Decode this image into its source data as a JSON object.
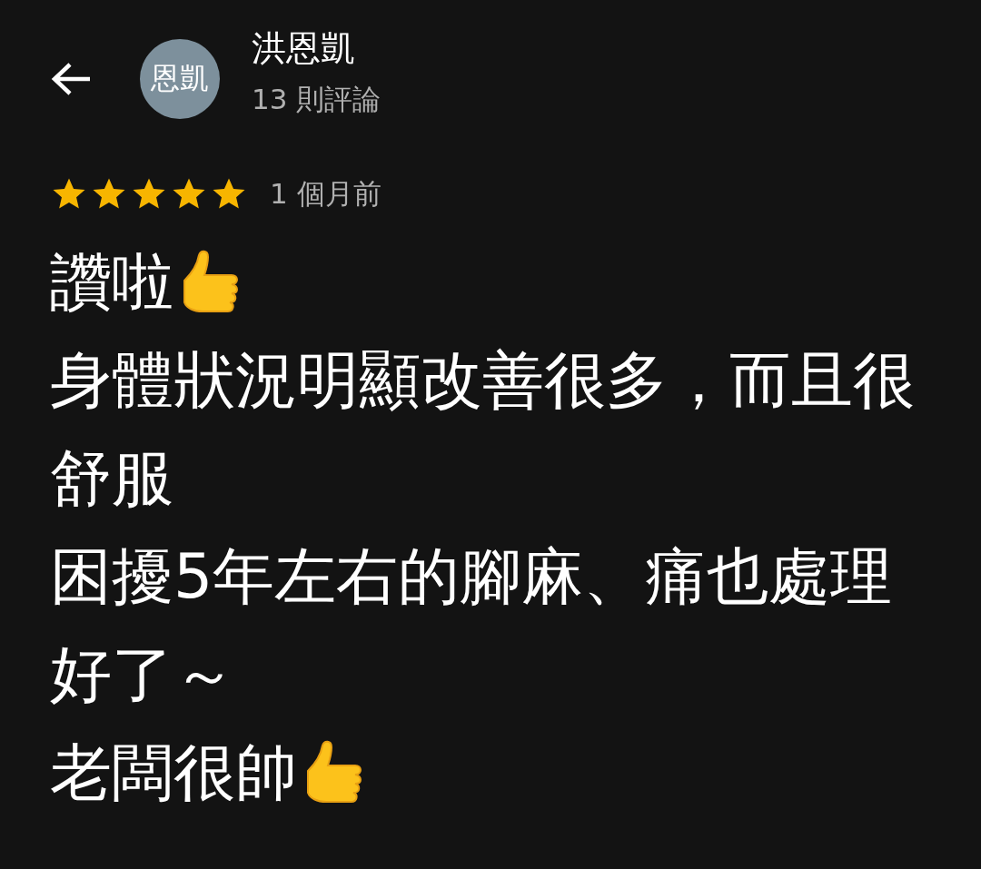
{
  "reviewer": {
    "avatar_text": "恩凱",
    "name": "洪恩凱",
    "review_count": "13 則評論"
  },
  "review": {
    "stars": 5,
    "time": "1 個月前",
    "lines": [
      {
        "text": "讚啦",
        "thumbs_up": true
      },
      {
        "text": "身體狀況明顯改善很多，而且很",
        "thumbs_up": false
      },
      {
        "text": "舒服",
        "thumbs_up": false
      },
      {
        "text": "困擾5年左右的腳麻、痛也處理",
        "thumbs_up": false
      },
      {
        "text": "好了～",
        "thumbs_up": false
      },
      {
        "text": "老闆很帥",
        "thumbs_up": true
      }
    ]
  }
}
